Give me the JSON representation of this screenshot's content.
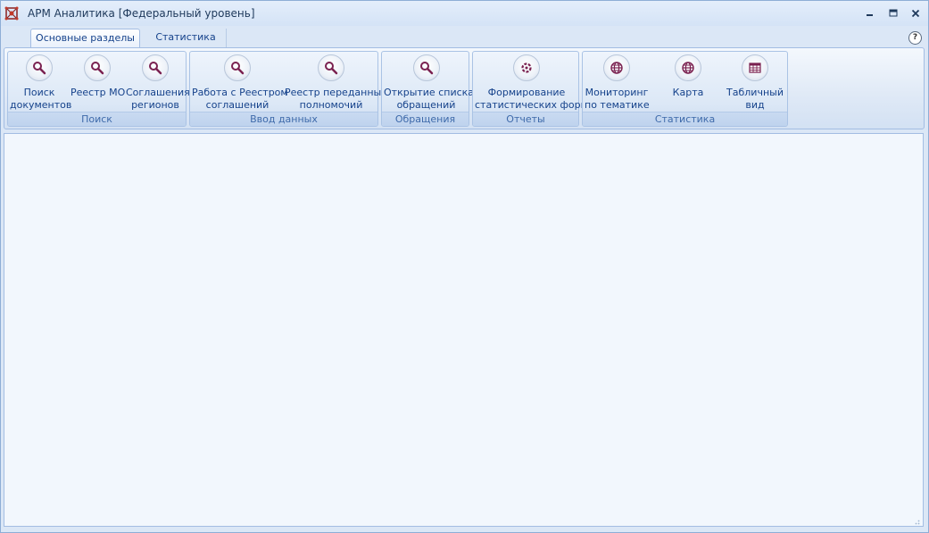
{
  "window": {
    "title": "АРМ Аналитика [Федеральный уровень]",
    "icon": "app-logo-icon",
    "controls": [
      "minimize-icon",
      "maximize-icon",
      "close-icon"
    ]
  },
  "tabs": [
    {
      "label": "Основные разделы",
      "active": true
    },
    {
      "label": "Статистика",
      "active": false
    }
  ],
  "help_label": "?",
  "ribbon": {
    "groups": [
      {
        "label": "Поиск",
        "buttons": [
          {
            "line1": "Поиск",
            "line2": "документов",
            "icon": "search-icon"
          },
          {
            "line1": "Реестр МО",
            "line2": "",
            "icon": "search-icon"
          },
          {
            "line1": "Соглашения",
            "line2": "регионов",
            "icon": "search-icon"
          }
        ]
      },
      {
        "label": "Ввод данных",
        "buttons": [
          {
            "line1": "Работа с Реестром",
            "line2": "соглашений",
            "icon": "search-icon"
          },
          {
            "line1": "Реестр переданных",
            "line2": "полномочий",
            "icon": "search-icon"
          }
        ]
      },
      {
        "label": "Обращения",
        "buttons": [
          {
            "line1": "Открытие списка",
            "line2": "обращений",
            "icon": "search-icon"
          }
        ]
      },
      {
        "label": "Отчеты",
        "buttons": [
          {
            "line1": "Формирование",
            "line2": "статистических форм",
            "icon": "refresh-gear-icon"
          }
        ]
      },
      {
        "label": "Статистика",
        "buttons": [
          {
            "line1": "Мониторинг",
            "line2": "по тематике",
            "icon": "globe-icon"
          },
          {
            "line1": "Карта",
            "line2": "",
            "icon": "globe-icon"
          },
          {
            "line1": "Табличный",
            "line2": "вид",
            "icon": "table-icon"
          }
        ]
      }
    ]
  },
  "colors": {
    "text": "#15428b",
    "group_label": "#3e6aaa",
    "icon_accent": "#7a2150",
    "frame": "#a3bde3"
  }
}
